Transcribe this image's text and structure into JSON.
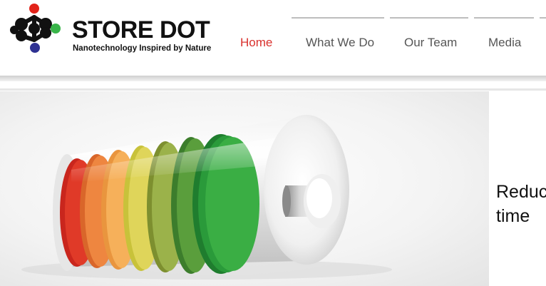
{
  "brand": {
    "name": "STORE DOT",
    "tagline": "Nanotechnology Inspired by Nature",
    "colors": {
      "red": "#e2231a",
      "green": "#39b54a",
      "blue": "#2e3192",
      "dark": "#111111"
    }
  },
  "nav": {
    "items": [
      {
        "label": "Home",
        "active": true
      },
      {
        "label": "What We Do",
        "active": false
      },
      {
        "label": "Our Team",
        "active": false
      },
      {
        "label": "Media",
        "active": false
      }
    ],
    "active_color": "#d9302c"
  },
  "hero": {
    "image": "battery-charge-icon",
    "headline_line1": "Reduc",
    "headline_line2": "time"
  }
}
